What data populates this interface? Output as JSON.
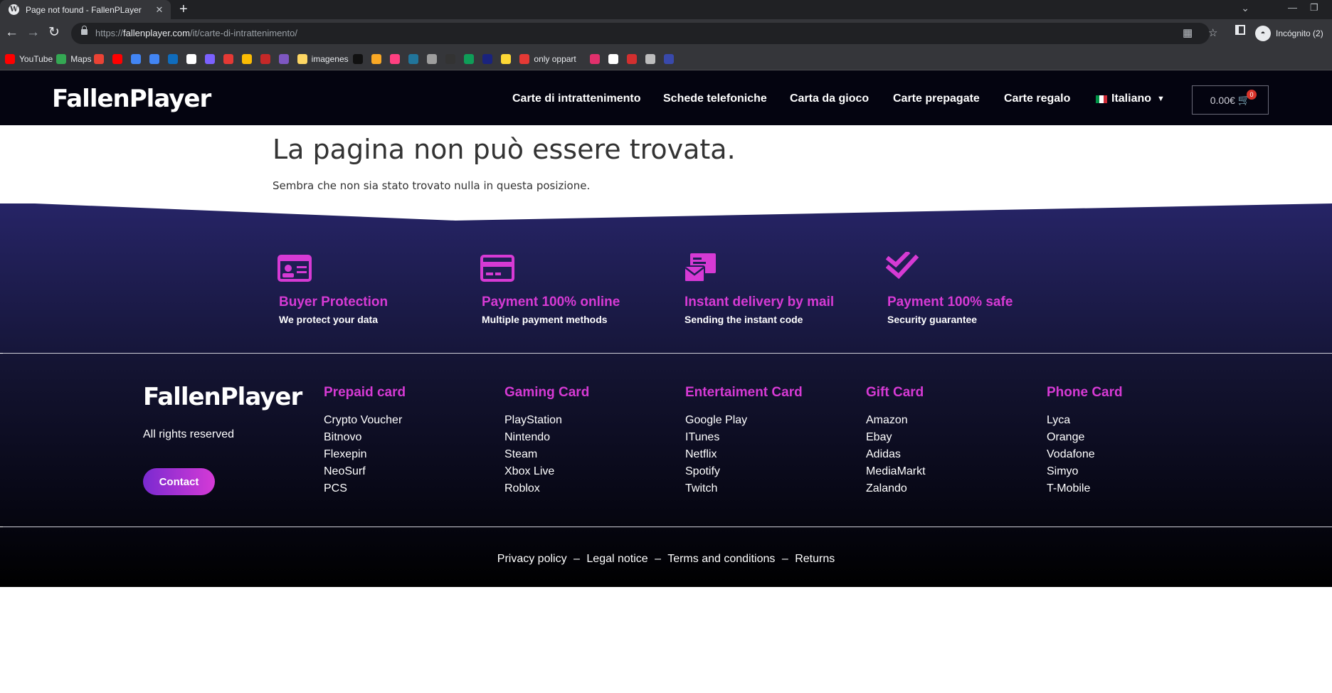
{
  "browser": {
    "tab_title": "Page not found - FallenPLayer",
    "tab_favicon": "W",
    "close_glyph": "✕",
    "new_tab_glyph": "+",
    "url_prefix": "https://",
    "url_host": "fallenplayer.com",
    "url_path": "/it/carte-di-intrattenimento/",
    "profile_label": "Incógnito (2)",
    "bookmarks": [
      {
        "label": "YouTube",
        "color": "#ff0000"
      },
      {
        "label": "Maps",
        "color": "#34a853"
      },
      {
        "label": "",
        "color": "#ea4335"
      },
      {
        "label": "",
        "color": "#ff0000"
      },
      {
        "label": "",
        "color": "#4285f4"
      },
      {
        "label": "",
        "color": "#4285f4"
      },
      {
        "label": "",
        "color": "#0f6cbd"
      },
      {
        "label": "",
        "color": "#ffffff"
      },
      {
        "label": "",
        "color": "#7b61ff"
      },
      {
        "label": "",
        "color": "#e53935"
      },
      {
        "label": "",
        "color": "#fbbc04"
      },
      {
        "label": "",
        "color": "#c62828"
      },
      {
        "label": "",
        "color": "#7e57c2"
      },
      {
        "label": "imagenes",
        "color": "#fdd663"
      },
      {
        "label": "",
        "color": "#111111"
      },
      {
        "label": "",
        "color": "#f9a825"
      },
      {
        "label": "",
        "color": "#ff4081"
      },
      {
        "label": "",
        "color": "#21759b"
      },
      {
        "label": "",
        "color": "#9e9e9e"
      },
      {
        "label": "",
        "color": "#333333"
      },
      {
        "label": "",
        "color": "#0f9d58"
      },
      {
        "label": "",
        "color": "#1a237e"
      },
      {
        "label": "",
        "color": "#fdd835"
      },
      {
        "label": "only oppart",
        "color": "#e53935"
      },
      {
        "label": "",
        "color": "#e1306c"
      },
      {
        "label": "",
        "color": "#ffffff"
      },
      {
        "label": "",
        "color": "#d32f2f"
      },
      {
        "label": "",
        "color": "#bdbdbd"
      },
      {
        "label": "",
        "color": "#3949ab"
      }
    ]
  },
  "header": {
    "logo": "FallenPlayer",
    "nav": [
      "Carte di intrattenimento",
      "Schede telefoniche",
      "Carta da gioco",
      "Carte prepagate",
      "Carte regalo"
    ],
    "language": "Italiano",
    "cart_total": "0.00€",
    "cart_count": "0",
    "cart_icon": "cart-icon"
  },
  "main": {
    "title": "La pagina non può essere trovata.",
    "description": "Sembra che non sia stato trovato nulla in questa posizione."
  },
  "features": [
    {
      "icon": "id-card-icon",
      "title": "Buyer Protection",
      "subtitle": "We protect your data"
    },
    {
      "icon": "credit-card-icon",
      "title": "Payment 100% online",
      "subtitle": "Multiple payment methods"
    },
    {
      "icon": "mail-delivery-icon",
      "title": "Instant delivery by mail",
      "subtitle": "Sending the instant code"
    },
    {
      "icon": "double-check-icon",
      "title": "Payment 100% safe",
      "subtitle": "Security guarantee"
    }
  ],
  "footer": {
    "logo": "FallenPlayer",
    "rights": "All rights reserved",
    "contact_label": "Contact",
    "columns": [
      {
        "title": "Prepaid card",
        "items": [
          "Crypto Voucher",
          "Bitnovo",
          "Flexepin",
          "NeoSurf",
          "PCS"
        ]
      },
      {
        "title": "Gaming Card",
        "items": [
          "PlayStation",
          "Nintendo",
          "Steam",
          "Xbox Live",
          "Roblox"
        ]
      },
      {
        "title": "Entertaiment Card",
        "items": [
          "Google Play",
          "ITunes",
          "Netflix",
          "Spotify",
          "Twitch"
        ]
      },
      {
        "title": "Gift Card",
        "items": [
          "Amazon",
          "Ebay",
          "Adidas",
          "MediaMarkt",
          "Zalando"
        ]
      },
      {
        "title": "Phone Card",
        "items": [
          "Lyca",
          "Orange",
          "Vodafone",
          "Simyo",
          "T-Mobile"
        ]
      }
    ],
    "bottom_links": [
      "Privacy policy",
      "Legal notice",
      "Terms and conditions",
      "Returns"
    ],
    "separator": "–"
  },
  "colors": {
    "accent": "#d63ad4",
    "header_bg": "#040410",
    "footer_top": "#262466",
    "footer_bottom": "#05050f"
  }
}
